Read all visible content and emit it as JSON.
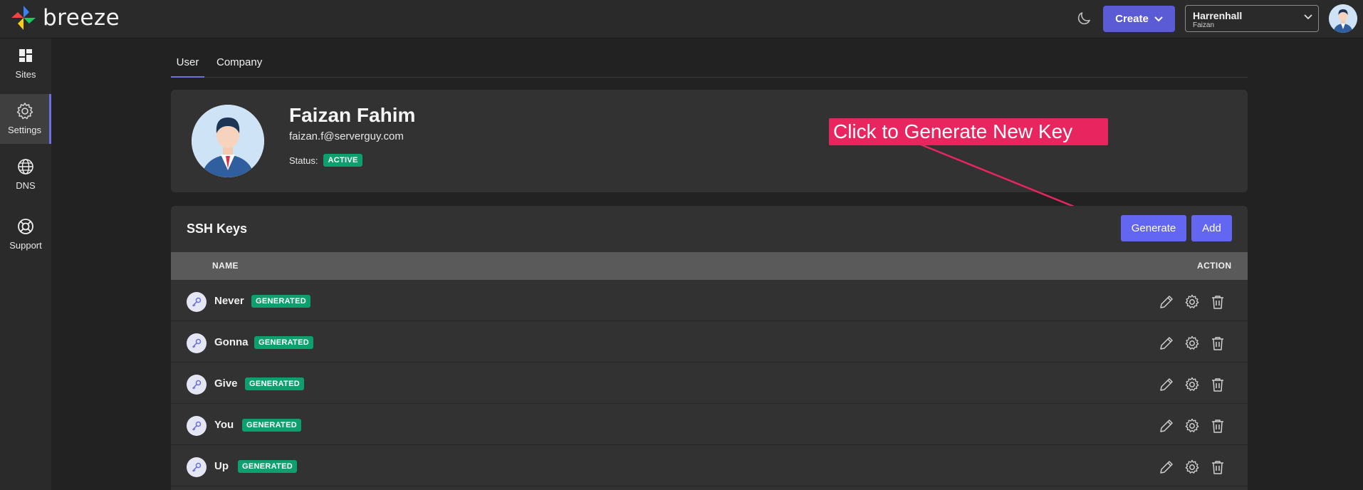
{
  "app": {
    "name": "breeze"
  },
  "header": {
    "create_label": "Create",
    "org": {
      "name": "Harrenhall",
      "user": "Faizan"
    }
  },
  "sidebar": {
    "items": [
      {
        "label": "Sites",
        "icon": "grid-icon"
      },
      {
        "label": "Settings",
        "icon": "gear-icon",
        "active": true
      },
      {
        "label": "DNS",
        "icon": "globe-icon"
      },
      {
        "label": "Support",
        "icon": "lifebuoy-icon"
      }
    ]
  },
  "tabs": [
    {
      "label": "User",
      "active": true
    },
    {
      "label": "Company"
    }
  ],
  "profile": {
    "name": "Faizan Fahim",
    "email": "faizan.f@serverguy.com",
    "status_label": "Status:",
    "status": "ACTIVE"
  },
  "callout": {
    "text": "Click to Generate New Key"
  },
  "ssh": {
    "title": "SSH Keys",
    "generate_label": "Generate",
    "add_label": "Add",
    "columns": {
      "name": "NAME",
      "action": "ACTION"
    },
    "rows": [
      {
        "name": "Never",
        "badge": "GENERATED"
      },
      {
        "name": "Gonna",
        "badge": "GENERATED"
      },
      {
        "name": "Give",
        "badge": "GENERATED"
      },
      {
        "name": "You",
        "badge": "GENERATED"
      },
      {
        "name": "Up",
        "badge": "GENERATED"
      }
    ]
  },
  "colors": {
    "accent": "#6366f1",
    "status_green": "#0d9f6e",
    "callout": "#e8255e",
    "background": "#222222",
    "card": "#323232"
  }
}
